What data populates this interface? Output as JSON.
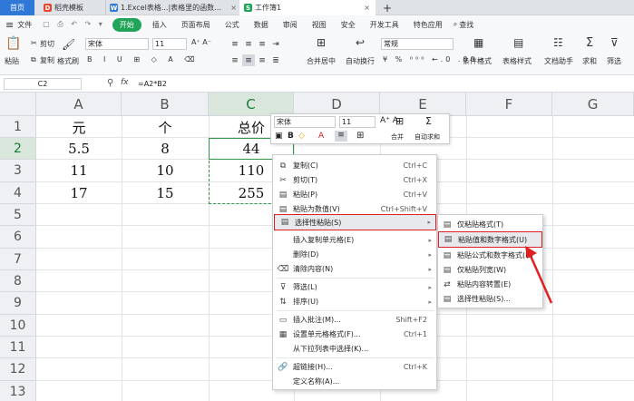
{
  "tabs": {
    "home": "首页",
    "tab1": "稻壳模板",
    "tab2": "1.Excel表格...|表格里的函数公式",
    "tab3": "工作簿1",
    "new_tab": "+"
  },
  "menu": {
    "hamburger": "≡",
    "file": "文件",
    "start": "开始",
    "insert": "插入",
    "page_layout": "页面布局",
    "formula": "公式",
    "data": "数据",
    "review": "审阅",
    "view": "视图",
    "security": "安全",
    "dev_tools": "开发工具",
    "special": "特色应用",
    "search": "查找"
  },
  "ribbon": {
    "paste": "粘贴",
    "cut": "剪切",
    "copy": "复制",
    "format_painter": "格式刷",
    "font_name": "宋体",
    "font_size": "11",
    "merge_center": "合并居中",
    "auto_wrap": "自动换行",
    "number_format": "常规",
    "cond_format": "条件格式",
    "table_style": "表格样式",
    "doc_helper": "文档助手",
    "sum": "求和",
    "filter": "筛选"
  },
  "formula_bar": {
    "cell_ref": "C2",
    "fx": "fx",
    "formula": "=A2*B2"
  },
  "columns": [
    "A",
    "B",
    "C",
    "D",
    "E",
    "F",
    "G"
  ],
  "rows": [
    "1",
    "2",
    "3",
    "4",
    "5",
    "6",
    "7",
    "8",
    "9",
    "10",
    "11",
    "12",
    "13"
  ],
  "cells": {
    "a1": "元",
    "b1": "个",
    "c1": "总价",
    "a2": "5.5",
    "b2": "8",
    "c2": "44",
    "a3": "11",
    "b3": "10",
    "c3": "110",
    "a4": "17",
    "b4": "15",
    "c4": "255"
  },
  "mini_toolbar": {
    "font_name": "宋体",
    "font_size": "11",
    "bold": "B",
    "merge": "合并",
    "auto_sum": "自动求和"
  },
  "context_menu": {
    "copy": "复制(C)",
    "copy_sc": "Ctrl+C",
    "cut": "剪切(T)",
    "cut_sc": "Ctrl+X",
    "paste": "粘贴(P)",
    "paste_sc": "Ctrl+V",
    "paste_values": "粘贴为数值(V)",
    "paste_values_sc": "Ctrl+Shift+V",
    "paste_special": "选择性粘贴(S)",
    "insert_copied": "插入复制单元格(E)",
    "delete": "删除(D)",
    "clear": "清除内容(N)",
    "filter": "筛选(L)",
    "sort": "排序(U)",
    "insert_comment": "插入批注(M)...",
    "insert_comment_sc": "Shift+F2",
    "format_cells": "设置单元格格式(F)...",
    "format_cells_sc": "Ctrl+1",
    "pick_list": "从下拉列表中选择(K)...",
    "hyperlink": "超链接(H)...",
    "hyperlink_sc": "Ctrl+K",
    "define_name": "定义名称(A)..."
  },
  "submenu": {
    "paste_format": "仅粘贴格式(T)",
    "paste_values_numfmt": "粘贴值和数字格式(U)",
    "paste_formula_numfmt": "粘贴公式和数字格式(R)",
    "paste_colwidth": "仅粘贴列宽(W)",
    "paste_transpose": "粘贴内容转置(E)",
    "paste_special": "选择性粘贴(S)..."
  },
  "colors": {
    "accent_green": "#1fa45a",
    "highlight_red": "#e02020",
    "selection_green": "#2e9a48"
  }
}
